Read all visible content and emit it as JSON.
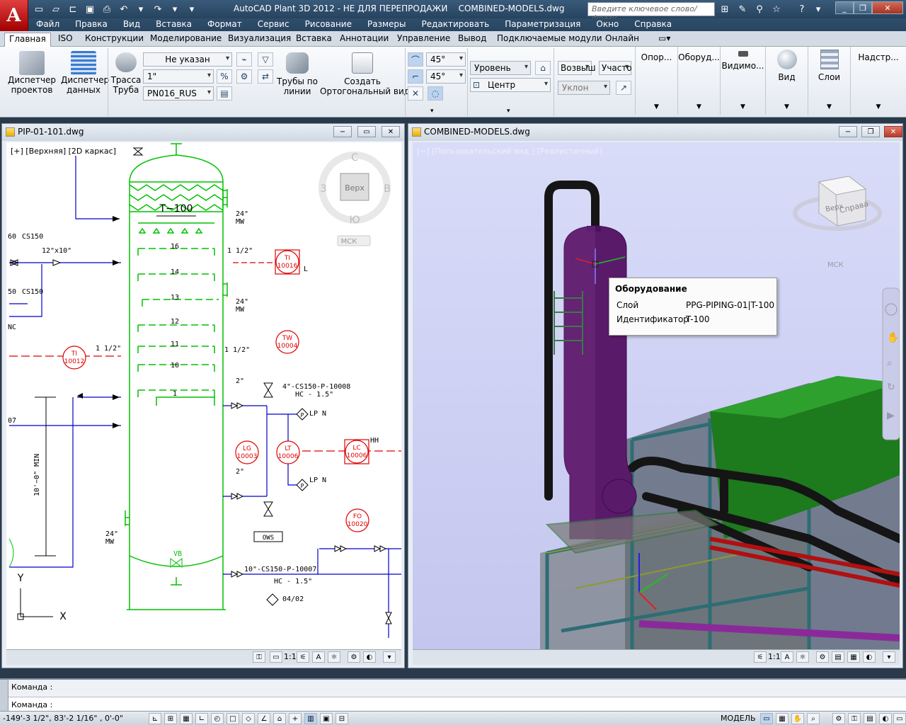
{
  "app": {
    "title": "AutoCAD Plant 3D 2012 - НЕ ДЛЯ ПЕРЕПРОДАЖИ",
    "document": "COMBINED-MODELS.dwg",
    "logo_letter": "A",
    "search_placeholder": "Введите ключевое слово/фразу"
  },
  "menu": [
    "Файл",
    "Правка",
    "Вид",
    "Вставка",
    "Формат",
    "Сервис",
    "Рисование",
    "Размеры",
    "Редактировать",
    "Параметризация",
    "Окно",
    "Справка"
  ],
  "ribbon_tabs": [
    "Главная",
    "ISO",
    "Конструкции",
    "Моделирование",
    "Визуализация",
    "Вставка",
    "Аннотации",
    "Управление",
    "Вывод",
    "Подключаемые модули",
    "Онлайн"
  ],
  "ribbon": {
    "project_manager": "Диспетчер\nпроектов",
    "data_manager": "Диспетчер\nданных",
    "route_pipe": "Трасса\nТруба",
    "spec_value": "Не указан",
    "size_value": "1\"",
    "class_value": "PN016_RUS",
    "pipes_by_line": "Трубы по\nлинии",
    "create_ortho": "Создать\nОртогональный вид",
    "angle1": "45°",
    "angle2": "45°",
    "level": "Уровень",
    "center": "Центр",
    "elevation": "Возвыш",
    "section": "Участо",
    "slope": "Уклон",
    "supports": "Опор...",
    "equipment": "Оборуд...",
    "visibility": "Видимо...",
    "view": "Вид",
    "layers": "Слои",
    "settings": "Надстр..."
  },
  "pid_window": {
    "title": "PIP-01-101.dwg",
    "viewport_label": "[+] [Верхняя] [2D каркас]",
    "cube_face": "Верх",
    "cube_n": "С",
    "cube_w": "З",
    "cube_e": "В",
    "cube_s": "Ю",
    "ucs": "МСК",
    "scale": "1:1",
    "tower_tag": "T−100",
    "trays": [
      "16",
      "14",
      "13",
      "12",
      "11",
      "10",
      "1"
    ],
    "labels": {
      "mw1": "24\"\nMW",
      "mw2": "24\"\nMW",
      "mw3": "24\"\nMW",
      "half1": "1 1/2\"",
      "half2": "1 1/2\"",
      "half3": "1 1/2\"",
      "cs150a": "CS150",
      "cs150b": "CS150",
      "size12": "12\"x10\"",
      "line1": "4\"-CS150-P-10008",
      "hc1": "HC  -  1.5\"",
      "line2": "10\"-CS150-P-10007",
      "hc2": "HC  -  1.5\"",
      "min": "10'−0\" MIN",
      "lpn1": "LP N",
      "lpn2": "LP N",
      "two1": "2\"",
      "two2": "2\"",
      "ows": "OWS",
      "vb": "VB",
      "v0402": "04/02",
      "nc": "NC",
      "l": "L",
      "hh": "HH",
      "p1": "P",
      "p2": "P",
      "n60": "60",
      "n07": "07",
      "n50": "50"
    },
    "instruments": [
      {
        "tag": "TI",
        "num": "10016"
      },
      {
        "tag": "TW",
        "num": "10004"
      },
      {
        "tag": "TI",
        "num": "10012"
      },
      {
        "tag": "LG",
        "num": "10003"
      },
      {
        "tag": "LT",
        "num": "10006"
      },
      {
        "tag": "LC",
        "num": "10006"
      },
      {
        "tag": "FO",
        "num": "10020"
      }
    ],
    "axis_y": "Y",
    "axis_x": "X"
  },
  "model_window": {
    "title": "COMBINED-MODELS.dwg",
    "viewport_label": "[−] [Пользовательский вид ] [Реалистичный]",
    "cube_left": "Верх",
    "cube_right": "Справа",
    "ucs": "МСК",
    "scale": "1:1"
  },
  "tooltip": {
    "title": "Оборудование",
    "layer_label": "Слой",
    "layer_value": "PPG-PIPING-01|T-100",
    "id_label": "Идентификатор",
    "id_value": "T-100"
  },
  "command": {
    "line1": "Команда :",
    "line2": "Команда :"
  },
  "status": {
    "coords": "-149'-3 1/2\", 83'-2 1/16\" , 0'-0\"",
    "model": "МОДЕЛЬ"
  },
  "colors": {
    "title_bg": "#26445f",
    "pid_green": "#00c000",
    "pid_red": "#e00000",
    "pid_blue": "#0000cc",
    "tower_purple": "#5a1a6a"
  }
}
